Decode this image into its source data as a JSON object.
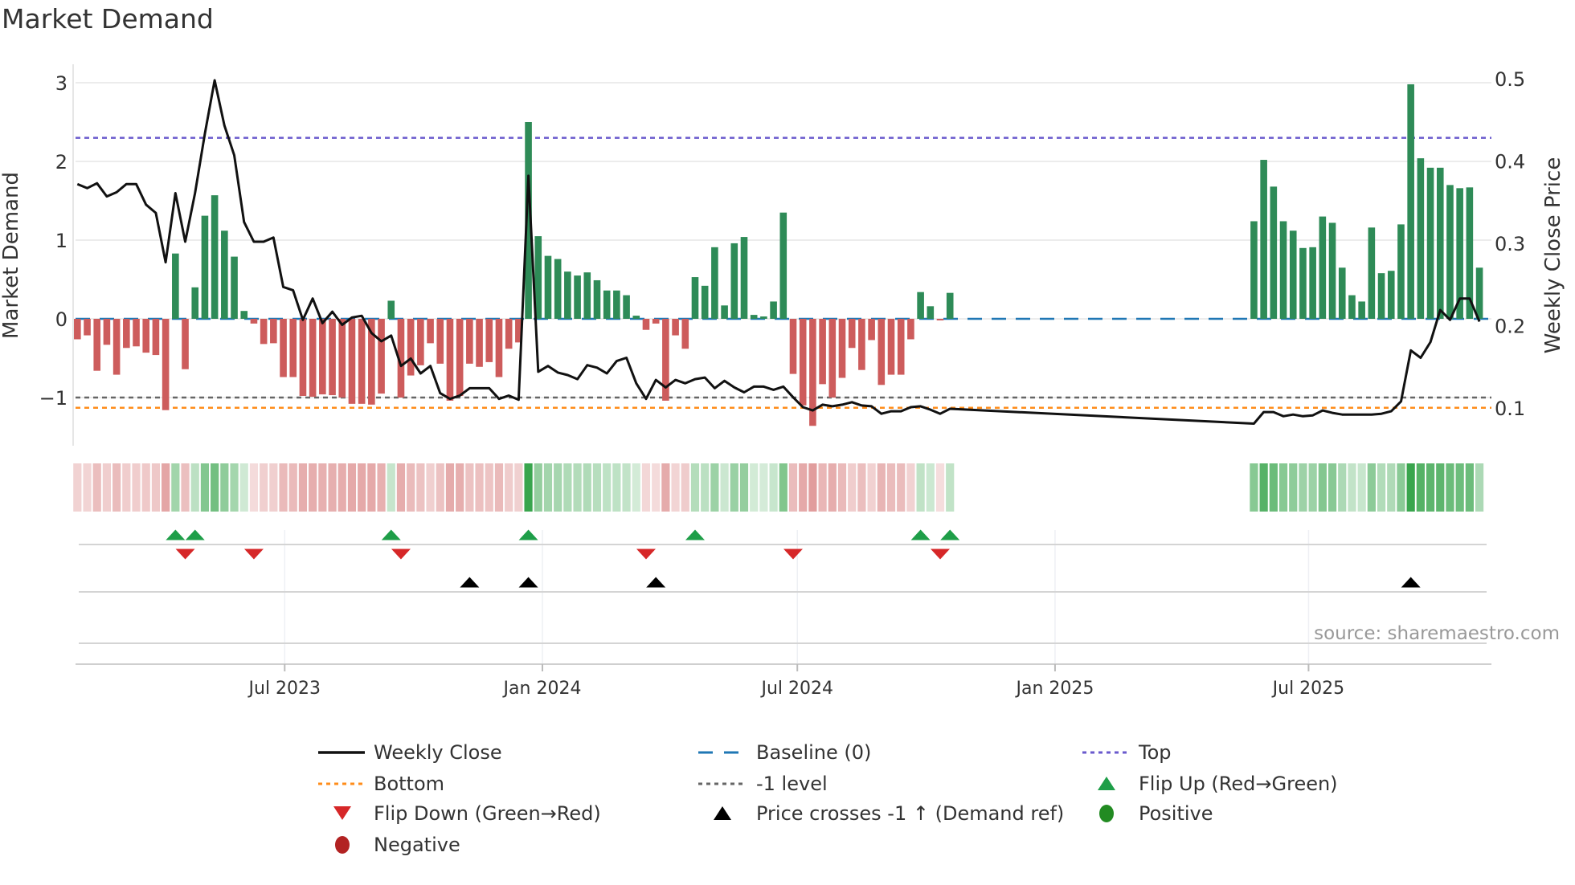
{
  "title": "Market Demand",
  "source": "source: sharemaestro.com",
  "colors": {
    "positive_bar": "#2e8b57",
    "negative_bar": "#cd5c5c",
    "close_line": "#111111",
    "baseline": "#1f77b4",
    "top": "#6a5acd",
    "bottom": "#ff8c1a",
    "minus_one": "#666666",
    "flip_up": "#1e9e48",
    "flip_down": "#d62728",
    "price_cross": "#000000",
    "positive_dot": "#228b22",
    "negative_dot": "#b22222"
  },
  "chart_data": {
    "type": "bar",
    "title": "Market Demand",
    "ylabel": "Market Demand",
    "y2label": "Weekly Close Price",
    "ylim": [
      -1.6,
      3.2
    ],
    "y2lim": [
      0.054,
      0.517
    ],
    "yticks": [
      {
        "v": 3,
        "label": "3"
      },
      {
        "v": 2,
        "label": "2"
      },
      {
        "v": 1,
        "label": "1"
      },
      {
        "v": 0,
        "label": "0"
      },
      {
        "v": -1,
        "label": "−1"
      }
    ],
    "y2ticks": [
      {
        "v": 0.5,
        "label": "0.5"
      },
      {
        "v": 0.4,
        "label": "0.4"
      },
      {
        "v": 0.3,
        "label": "0.3"
      },
      {
        "v": 0.2,
        "label": "0.2"
      },
      {
        "v": 0.1,
        "label": "0.1"
      }
    ],
    "xticks": [
      {
        "date": "2023-07-01",
        "label": "Jul 2023"
      },
      {
        "date": "2024-01-01",
        "label": "Jan 2024"
      },
      {
        "date": "2024-07-01",
        "label": "Jul 2024"
      },
      {
        "date": "2025-01-01",
        "label": "Jan 2025"
      },
      {
        "date": "2025-07-01",
        "label": "Jul 2025"
      }
    ],
    "levels": {
      "baseline": 0,
      "top": 2.3,
      "bottom": -1.13,
      "minus_one": -1
    },
    "segments": [
      {
        "start": "2023-02-03",
        "demand": [
          -0.26,
          -0.21,
          -0.66,
          -0.33,
          -0.71,
          -0.37,
          -0.35,
          -0.43,
          -0.46,
          -1.16,
          0.83,
          -0.64,
          0.4,
          1.31,
          1.57,
          1.12,
          0.79,
          0.1,
          -0.06,
          -0.32,
          -0.31,
          -0.74,
          -0.74,
          -0.98,
          -0.99,
          -0.96,
          -0.97,
          -1.0,
          -1.08,
          -1.08,
          -1.09,
          -0.95,
          0.23,
          -1.0,
          -0.72,
          -0.59,
          -0.31,
          -0.57,
          -1.04,
          -0.98,
          -0.57,
          -0.61,
          -0.55,
          -0.74,
          -0.38,
          -0.3,
          2.5,
          1.05,
          0.8,
          0.76,
          0.6,
          0.55,
          0.59,
          0.49,
          0.36,
          0.36,
          0.3,
          0.04,
          -0.14,
          -0.06,
          -1.04,
          -0.21,
          -0.38,
          0.53,
          0.42,
          0.91,
          0.17,
          0.96,
          1.04,
          0.05,
          0.03,
          0.22,
          1.35,
          -0.7,
          -1.1,
          -1.36,
          -0.83,
          -1.0,
          -0.75,
          -0.37,
          -0.65,
          -0.27,
          -0.84,
          -0.71,
          -0.71,
          -0.26,
          0.34,
          0.16,
          -0.02,
          0.33
        ],
        "close": [
          0.372,
          0.367,
          0.373,
          0.357,
          0.362,
          0.372,
          0.372,
          0.347,
          0.337,
          0.277,
          0.361,
          0.302,
          0.361,
          0.433,
          0.498,
          0.443,
          0.407,
          0.326,
          0.302,
          0.302,
          0.307,
          0.247,
          0.243,
          0.207,
          0.233,
          0.203,
          0.217,
          0.201,
          0.21,
          0.212,
          0.191,
          0.181,
          0.188,
          0.151,
          0.16,
          0.142,
          0.151,
          0.118,
          0.111,
          0.115,
          0.124,
          0.124,
          0.124,
          0.111,
          0.115,
          0.11,
          0.382,
          0.144,
          0.151,
          0.143,
          0.14,
          0.135,
          0.152,
          0.149,
          0.142,
          0.157,
          0.161,
          0.13,
          0.111,
          0.134,
          0.125,
          0.134,
          0.13,
          0.135,
          0.137,
          0.124,
          0.133,
          0.125,
          0.119,
          0.126,
          0.126,
          0.122,
          0.126,
          0.113,
          0.101,
          0.097,
          0.104,
          0.102,
          0.104,
          0.107,
          0.103,
          0.102,
          0.093,
          0.096,
          0.096,
          0.101,
          0.102,
          0.098,
          0.093,
          0.099
        ]
      },
      {
        "start": "2025-05-23",
        "demand": [
          1.24,
          2.02,
          1.68,
          1.24,
          1.12,
          0.9,
          0.91,
          1.3,
          1.22,
          0.65,
          0.3,
          0.22,
          1.16,
          0.58,
          0.61,
          1.2,
          2.98,
          2.04,
          1.92,
          1.92,
          1.7,
          1.66,
          1.67,
          0.65
        ],
        "close": [
          0.081,
          0.095,
          0.095,
          0.09,
          0.092,
          0.09,
          0.091,
          0.097,
          0.094,
          0.092,
          0.092,
          0.092,
          0.092,
          0.093,
          0.096,
          0.108,
          0.17,
          0.161,
          0.18,
          0.219,
          0.207,
          0.233,
          0.233,
          0.205
        ]
      }
    ],
    "flip_up": [
      10,
      12,
      32,
      46,
      63,
      86,
      89
    ],
    "flip_down": [
      11,
      18,
      33,
      58,
      73,
      88
    ],
    "price_cross": [
      40,
      46,
      59,
      106
    ]
  },
  "legend": [
    {
      "label": "Weekly Close",
      "icon": "solid-line",
      "color": "#111111"
    },
    {
      "label": "Baseline (0)",
      "icon": "dashed-line",
      "color": "#1f77b4"
    },
    {
      "label": "Top",
      "icon": "dotted-line",
      "color": "#6a5acd"
    },
    {
      "label": "Bottom",
      "icon": "dotted-line",
      "color": "#ff8c1a"
    },
    {
      "label": "-1 level",
      "icon": "dotted-line",
      "color": "#666666"
    },
    {
      "label": "Flip Up (Red→Green)",
      "icon": "triangle-up",
      "color": "#1e9e48"
    },
    {
      "label": "Flip Down (Green→Red)",
      "icon": "triangle-down",
      "color": "#d62728"
    },
    {
      "label": "Price crosses -1 ↑ (Demand ref)",
      "icon": "triangle-up",
      "color": "#000000"
    },
    {
      "label": "Positive",
      "icon": "circle",
      "color": "#228b22"
    },
    {
      "label": "Negative",
      "icon": "circle",
      "color": "#b22222"
    }
  ]
}
